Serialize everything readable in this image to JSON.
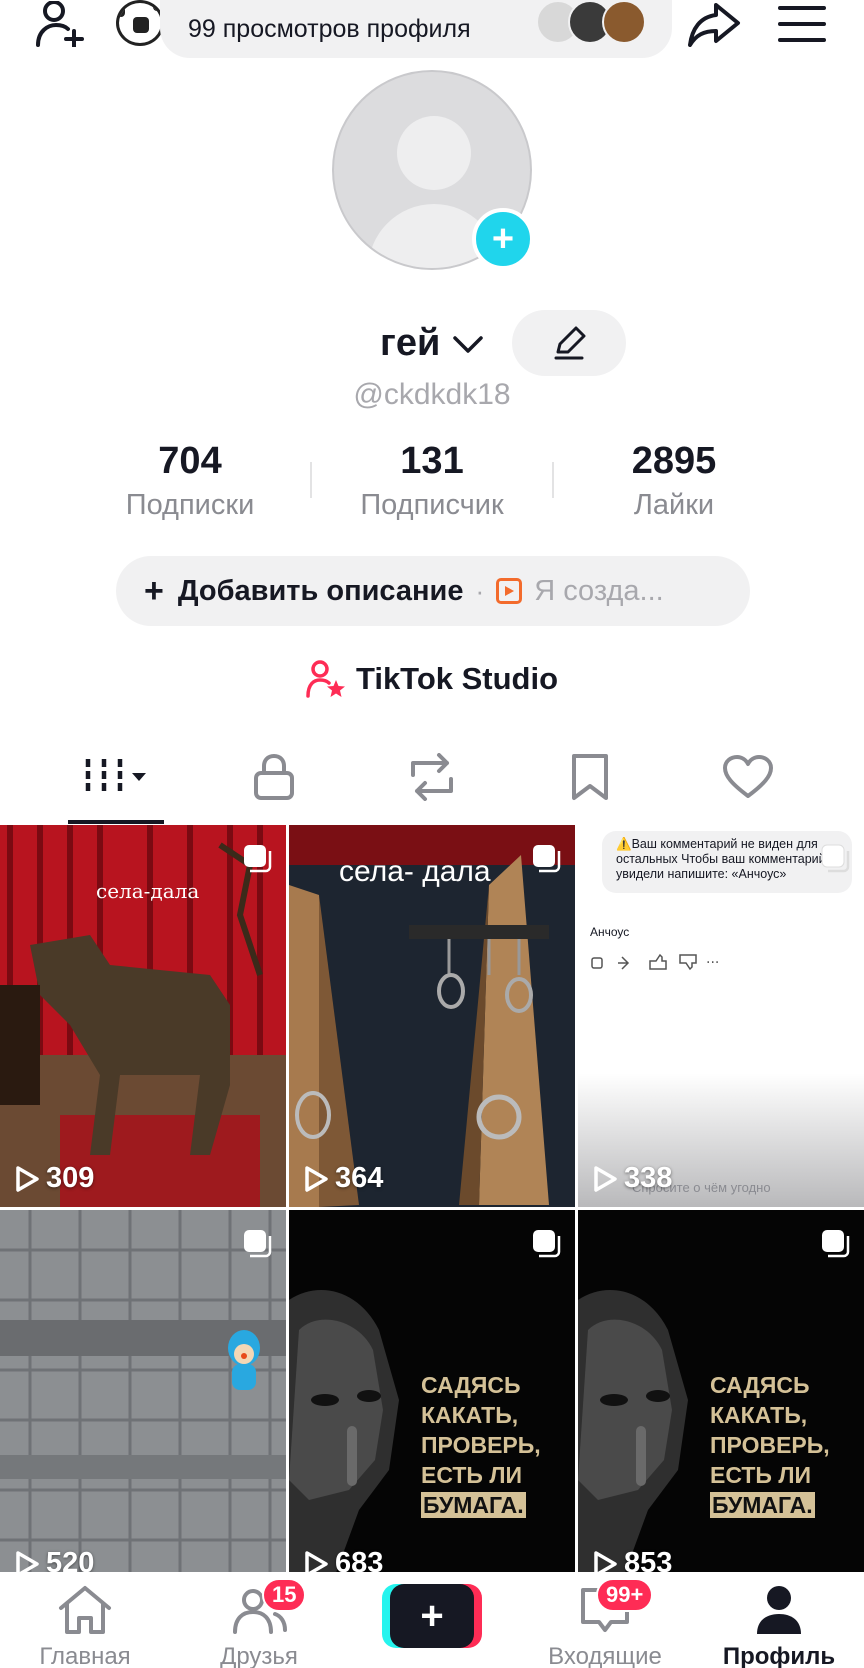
{
  "topbar": {
    "views_text": "99 просмотров профиля",
    "icons": [
      "add-friend-icon",
      "soccer-ball-icon",
      "share-icon",
      "menu-icon"
    ]
  },
  "profile": {
    "display_name": "гей",
    "handle": "@ckdkdk18",
    "stats": [
      {
        "value": "704",
        "label": "Подписки"
      },
      {
        "value": "131",
        "label": "Подписчик"
      },
      {
        "value": "2895",
        "label": "Лайки"
      }
    ],
    "add_description": "Добавить описание",
    "separator": "·",
    "creator_label": "Я созда...",
    "studio_label": "TikTok Studio"
  },
  "tabs": [
    "videos-grid-icon",
    "lock-icon",
    "repost-icon",
    "bookmark-icon",
    "heart-icon"
  ],
  "videos": [
    {
      "plays": "309",
      "caption": "села-дала"
    },
    {
      "plays": "364",
      "caption": "села- дала"
    },
    {
      "plays": "338",
      "comment_text": "⚠️Ваш комментарий не виден для остальных Чтобы ваш комментарий увидели напишите: «Анчоус»",
      "comment_author": "Анчоус",
      "footer_text": "Спросите о чём угодно"
    },
    {
      "plays": "520"
    },
    {
      "plays": "683",
      "caption_lines": [
        "САДЯСЬ КАКАТЬ,",
        "ПРОВЕРЬ,",
        "ЕСТЬ ЛИ"
      ],
      "caption_highlight": "БУМАГА."
    },
    {
      "plays": "853",
      "caption_lines": [
        "САДЯСЬ КАКАТЬ,",
        "ПРОВЕРЬ,",
        "ЕСТЬ ЛИ"
      ],
      "caption_highlight": "БУМАГА."
    }
  ],
  "nav": {
    "home": "Главная",
    "friends": "Друзья",
    "friends_badge": "15",
    "inbox": "Входящие",
    "inbox_badge": "99+",
    "profile": "Профиль"
  },
  "colors": {
    "accent_cyan": "#20d5ec",
    "brand_red": "#fe2c55",
    "brand_cyan": "#25f4ee",
    "creator_orange": "#f36b2c"
  }
}
